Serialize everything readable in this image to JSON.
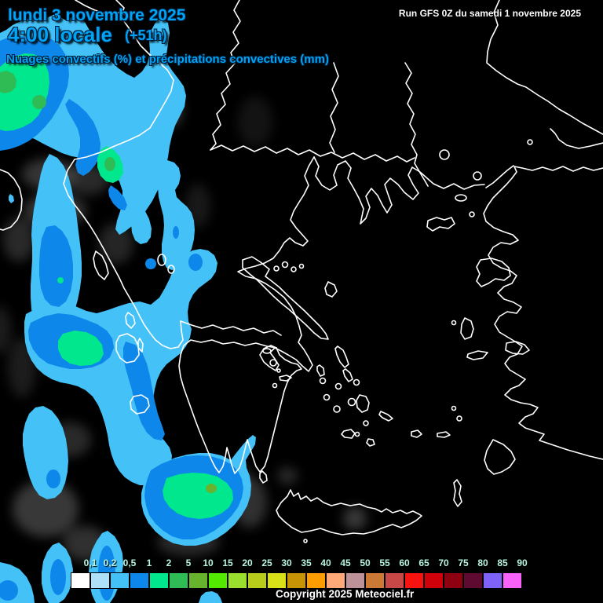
{
  "header": {
    "date_line": "lundi 3 novembre 2025",
    "time_line": "4:00 locale",
    "forecast_offset": "(+51h)",
    "subtitle": "Nuages convectifs (%) et précipitations convectives (mm)",
    "run_info": "Run GFS 0Z du samedi 1 novembre 2025"
  },
  "legend": {
    "unit_labels": [
      "0,1",
      "0,2",
      "0,5",
      "1",
      "2",
      "5",
      "10",
      "15",
      "20",
      "25",
      "30",
      "35",
      "40",
      "45",
      "50",
      "55",
      "60",
      "65",
      "70",
      "75",
      "80",
      "85",
      "90"
    ],
    "colors": [
      "#ffffff",
      "#b0e0f8",
      "#44c1f7",
      "#0d87ea",
      "#00e78e",
      "#30bc55",
      "#68b32e",
      "#52e800",
      "#9ade2e",
      "#b8cc1b",
      "#d8e018",
      "#c79406",
      "#ff9c00",
      "#ffa878",
      "#bd9399",
      "#cc7936",
      "#c84848",
      "#f81311",
      "#cf010b",
      "#8e0110",
      "#5e0a31",
      "#7f63f8",
      "#f862f8"
    ]
  },
  "footer": {
    "copyright": "Copyright 2025 Meteociel.fr"
  },
  "map": {
    "colors": {
      "background": "#000000",
      "coastline": "#ffffff",
      "title_blue": "#00a4f6",
      "legend_label": "#b7f7e0",
      "rain_0_2_to_0_5": "#44c1f7",
      "rain_0_5_to_1": "#0d87ea",
      "rain_1_to_2": "#00e78e",
      "rain_2_to_5": "#30bc55",
      "rain_5_to_10": "#68b32e",
      "cloud_gray": "#bbbbbb"
    }
  }
}
